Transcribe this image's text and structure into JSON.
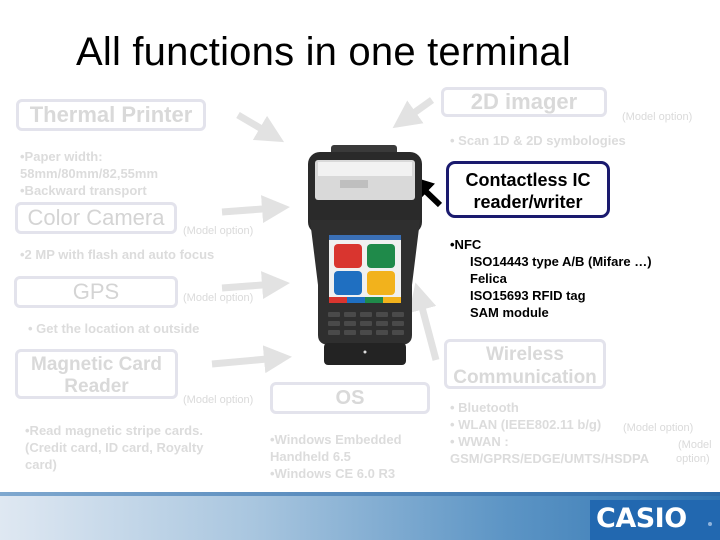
{
  "title": "All functions in one terminal",
  "features": {
    "thermal_printer": {
      "label": "Thermal Printer",
      "bullets": [
        "•Paper width:",
        " 58mm/80mm/82,55mm",
        "•Backward transport"
      ]
    },
    "imager_2d": {
      "label": "2D imager",
      "option": "(Model option)",
      "bullets": [
        "• Scan 1D & 2D symbologies"
      ]
    },
    "contactless_ic": {
      "label_line1": "Contactless IC",
      "label_line2": "reader/writer",
      "bullets": [
        "•NFC",
        "ISO14443 type A/B (Mifare …)",
        "Felica",
        "ISO15693 RFID tag",
        "SAM module"
      ]
    },
    "color_camera": {
      "label": "Color Camera",
      "option": "(Model option)",
      "bullets": [
        "•2 MP with flash and auto focus"
      ]
    },
    "gps": {
      "label": "GPS",
      "option": "(Model option)",
      "bullets": [
        "• Get the location at outside"
      ]
    },
    "magnetic_card": {
      "label_line1": "Magnetic Card",
      "label_line2": "Reader",
      "option": "(Model option)",
      "bullets": [
        "•Read magnetic stripe cards.",
        " (Credit card, ID card, Royalty",
        " card)"
      ]
    },
    "os": {
      "label": "OS",
      "bullets": [
        "•Windows Embedded",
        " Handheld 6.5",
        "•Windows CE 6.0 R3"
      ]
    },
    "wireless": {
      "label_line1": "Wireless",
      "label_line2": "Communication",
      "bullets": [
        "• Bluetooth",
        "• WLAN (IEEE802.11 b/g)",
        "• WWAN :",
        " GSM/GPRS/EDGE/UMTS/HSDPA"
      ],
      "wlan_option": "(Model option)",
      "wwan_option_line1": "(Model",
      "wwan_option_line2": "option)"
    }
  },
  "device": {
    "name": "handheld-terminal",
    "tile_colors": [
      "#d9352f",
      "#1f8a4a",
      "#1f6fc1",
      "#f2b21c"
    ],
    "bottom_bar_colors": [
      "#d9352f",
      "#1f6fc1",
      "#1f8a4a",
      "#f2b21c"
    ]
  },
  "brand": {
    "logo_text": "CASIO"
  }
}
